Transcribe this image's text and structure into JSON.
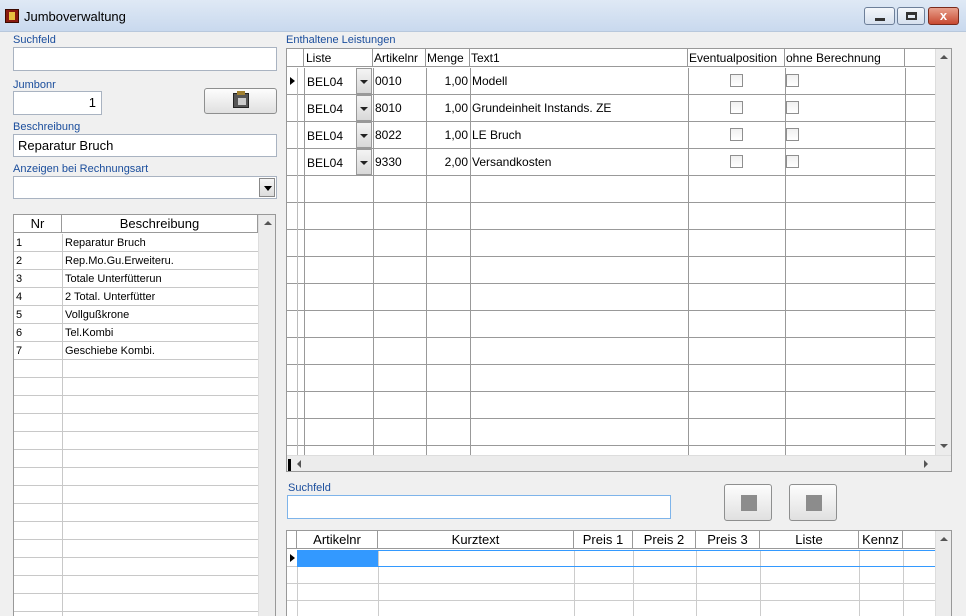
{
  "window": {
    "title": "Jumboverwaltung",
    "close_glyph": "x"
  },
  "left": {
    "suchfeld_label": "Suchfeld",
    "suchfeld_value": "",
    "jumbonr_label": "Jumbonr",
    "jumbonr_value": "1",
    "beschreibung_label": "Beschreibung",
    "beschreibung_value": "Reparatur Bruch",
    "anzeigen_label": "Anzeigen bei Rechnungsart",
    "anzeigen_value": "",
    "paste_icon": "clipboard-icon",
    "list": {
      "headers": [
        "Nr",
        "Beschreibung"
      ],
      "rows": [
        {
          "nr": "1",
          "text": "Reparatur Bruch"
        },
        {
          "nr": "2",
          "text": "Rep.Mo.Gu.Erweiteru."
        },
        {
          "nr": "3",
          "text": "Totale Unterfütterun"
        },
        {
          "nr": "4",
          "text": "2 Total. Unterfütter"
        },
        {
          "nr": "5",
          "text": "Vollgußkrone"
        },
        {
          "nr": "6",
          "text": "Tel.Kombi"
        },
        {
          "nr": "7",
          "text": "Geschiebe Kombi."
        }
      ]
    }
  },
  "right": {
    "enthaltene_label": "Enthaltene Leistungen",
    "grid": {
      "headers": [
        "Liste",
        "Artikelnr",
        "Menge",
        "Text1",
        "Eventualposition",
        "ohne Berechnung"
      ],
      "rows": [
        {
          "liste": "BEL04",
          "artikelnr": "0010",
          "menge": "1,00",
          "text1": "Modell",
          "eventual": false,
          "ohne": false
        },
        {
          "liste": "BEL04",
          "artikelnr": "8010",
          "menge": "1,00",
          "text1": "Grundeinheit Instands. ZE",
          "eventual": false,
          "ohne": false
        },
        {
          "liste": "BEL04",
          "artikelnr": "8022",
          "menge": "1,00",
          "text1": "LE Bruch",
          "eventual": false,
          "ohne": false
        },
        {
          "liste": "BEL04",
          "artikelnr": "9330",
          "menge": "2,00",
          "text1": "Versandkosten",
          "eventual": false,
          "ohne": false
        }
      ]
    },
    "suchfeld_label": "Suchfeld",
    "suchfeld_value": "",
    "article_grid": {
      "headers": [
        "Artikelnr",
        "Kurztext",
        "Preis 1",
        "Preis 2",
        "Preis 3",
        "Liste",
        "Kennz"
      ]
    }
  },
  "colors": {
    "label_blue": "#1a4d9c",
    "selection_border": "#3399ff"
  }
}
